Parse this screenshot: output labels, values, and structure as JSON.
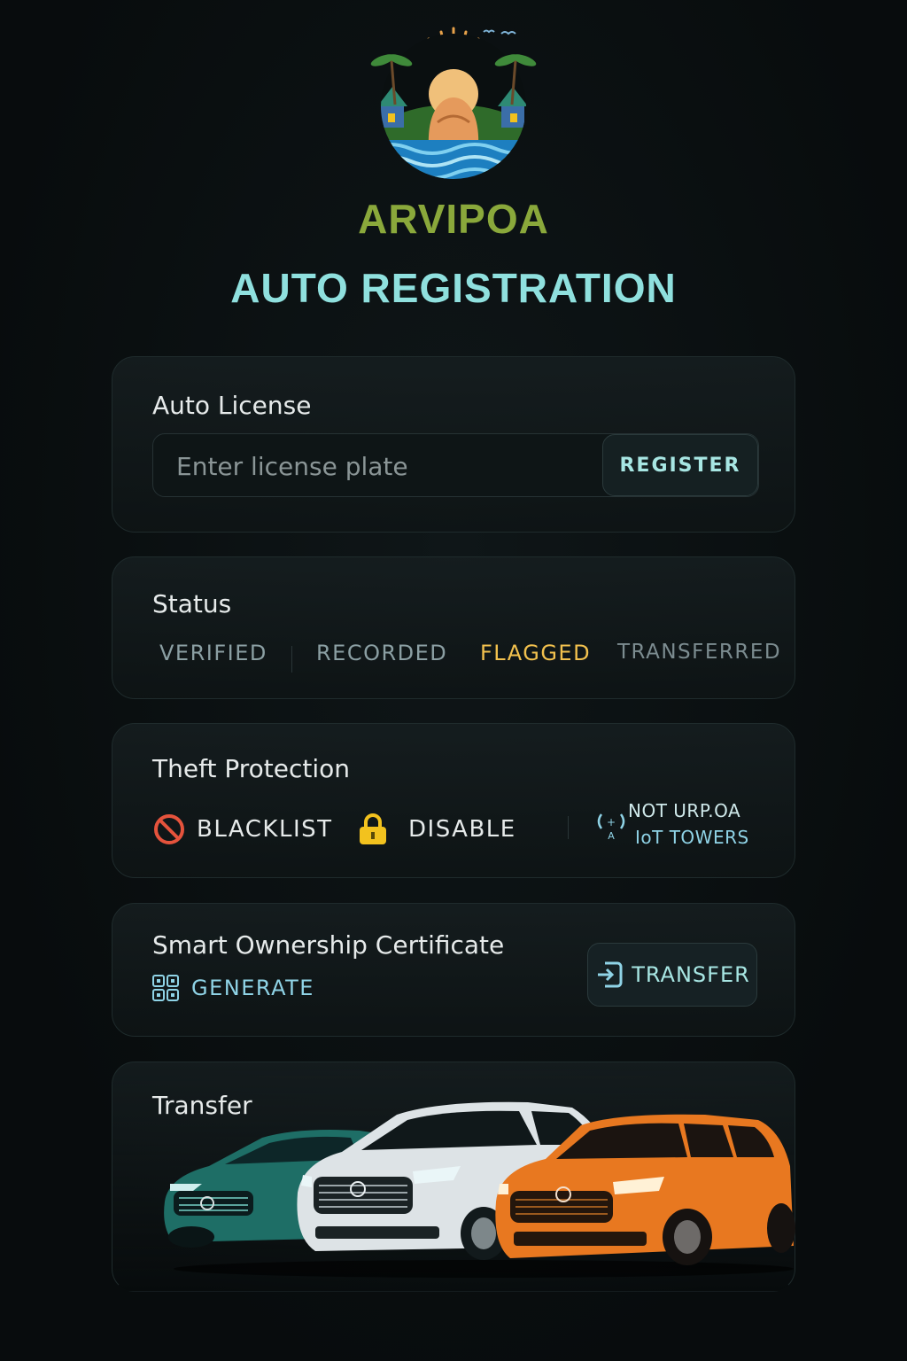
{
  "brand": {
    "name": "ARVIPOA"
  },
  "header": {
    "title": "AUTO REGISTRATION"
  },
  "license": {
    "label": "Auto License",
    "placeholder": "Enter license plate",
    "register_label": "REGISTER"
  },
  "status": {
    "label": "Status",
    "items": [
      {
        "label": "VERIFIED",
        "color": "#8b9fa3"
      },
      {
        "label": "RECORDED",
        "color": "#8b9fa3"
      },
      {
        "label": "FLAGGED",
        "color": "#f2c14e"
      },
      {
        "label": "TRANSFERRED",
        "color": "#7c8c90"
      }
    ]
  },
  "theft": {
    "label": "Theft Protection",
    "blacklist_label": "BLACKLIST",
    "disable_label": "DISABLE",
    "iot_line1": "NOT URP.OA",
    "iot_line2": "IoT TOWERS"
  },
  "certificate": {
    "label": "Smart Ownership Certificate",
    "generate_label": "GENERATE",
    "transfer_label": "TRANSFER"
  },
  "transfer": {
    "label": "Transfer"
  },
  "colors": {
    "brand": "#8aa83b",
    "title": "#8fe0de",
    "flagged": "#f2c14e",
    "blacklist": "#e5533c",
    "lock": "#f2c21e",
    "car_teal": "#1e6e66",
    "car_white": "#dde3e6",
    "car_orange": "#e87820"
  }
}
